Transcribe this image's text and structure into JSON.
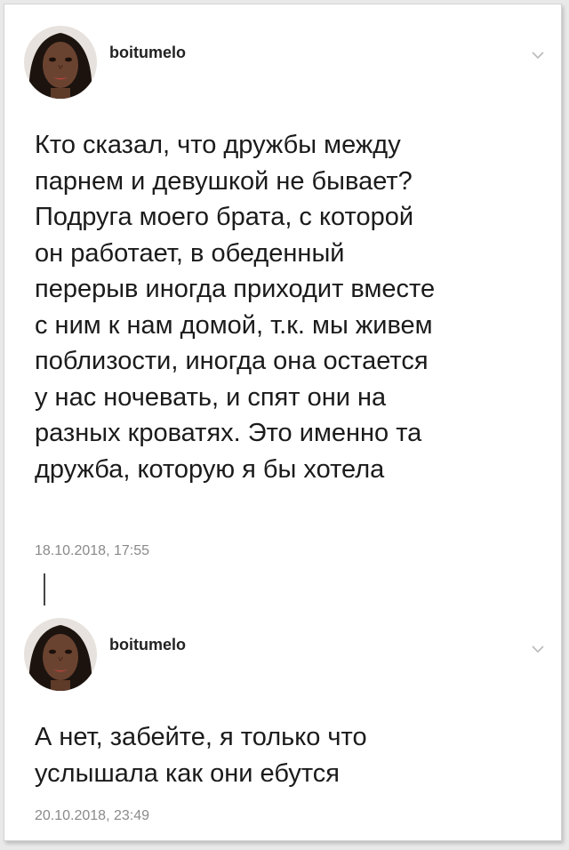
{
  "posts": [
    {
      "username": "boitumelo",
      "text": "Кто сказал, что дружбы между\nпарнем и девушкой не бывает?\nПодруга моего брата, с которой\nон работает, в обеденный\nперерыв иногда приходит вместе\nс ним к нам домой, т.к. мы живем\nпоблизости, иногда она остается\nу нас ночевать, и спят они на\nразных кроватях. Это именно та\nдружба, которую я бы хотела",
      "timestamp": "18.10.2018, 17:55",
      "icon": "chevron-down-icon"
    },
    {
      "username": "boitumelo",
      "text": "А нет, забейте, я только что\nуслышала как они ебутся",
      "timestamp": "20.10.2018, 23:49",
      "icon": "chevron-down-icon"
    }
  ],
  "colors": {
    "background": "#e9e9e9",
    "card": "#ffffff",
    "timestamp": "#8a8a8a",
    "chevron": "#b9b9b9"
  }
}
